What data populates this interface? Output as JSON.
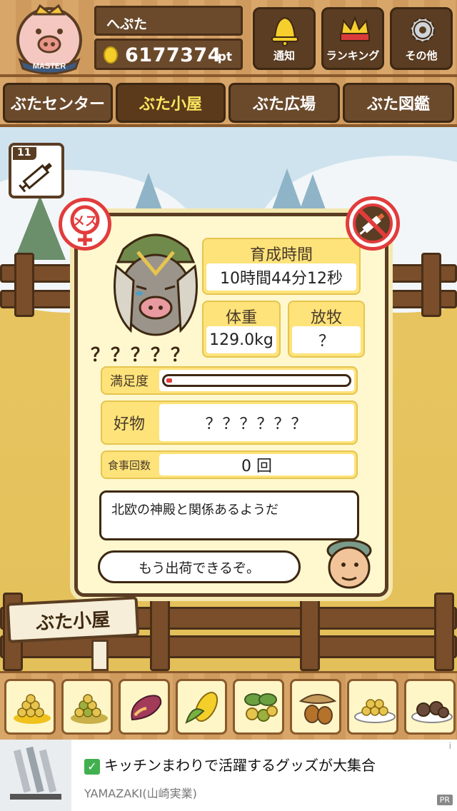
{
  "header": {
    "user_name": "へぷた",
    "points_value": "6177374",
    "points_unit": "pt",
    "badge_text": "MASTER",
    "buttons": [
      {
        "label": "通知",
        "icon": "bell-icon"
      },
      {
        "label": "ランキング",
        "icon": "crown-icon"
      },
      {
        "label": "その他",
        "icon": "gear-icon"
      }
    ]
  },
  "tabs": [
    {
      "label": "ぶたセンター",
      "active": false
    },
    {
      "label": "ぶた小屋",
      "active": true
    },
    {
      "label": "ぶた広場",
      "active": false
    },
    {
      "label": "ぶた図鑑",
      "active": false
    }
  ],
  "injection": {
    "count": "11",
    "icon": "syringe-icon"
  },
  "pig": {
    "gender_label": "メス",
    "name": "？？？？？",
    "raise_time_label": "育成時間",
    "raise_time_value": "10時間44分12秒",
    "weight_label": "体重",
    "weight_value": "129.0kg",
    "grazing_label": "放牧",
    "grazing_value": "？",
    "satisfaction_label": "満足度",
    "satisfaction_level": 0.03,
    "favorite_label": "好物",
    "favorite_value": "？？？？？？",
    "meals_label": "食事回数",
    "meals_value": "0 回",
    "description": "北欧の神殿と関係あるようだ",
    "farmer_speech": "もう出荷できるぞ。"
  },
  "sign_label": "ぶた小屋",
  "foods": [
    "grain-icon",
    "grain-mixed-icon",
    "sweet-potato-icon",
    "corn-icon",
    "vegetables-icon",
    "acorn-icon",
    "rice-bowl-icon",
    "meatball-icon"
  ],
  "ad": {
    "title": "キッチンまわりで活躍するグッズが大集合",
    "sponsor": "YAMAZAKI(山崎実業)",
    "pr_label": "PR",
    "info_label": "i"
  },
  "colors": {
    "wood": "#d9a66a",
    "dark_wood": "#5a3d22",
    "card_bg": "#fff8cf",
    "label_yellow": "#fde37a",
    "female_red": "#e23c3c",
    "active_tab_text": "#ffe760"
  }
}
